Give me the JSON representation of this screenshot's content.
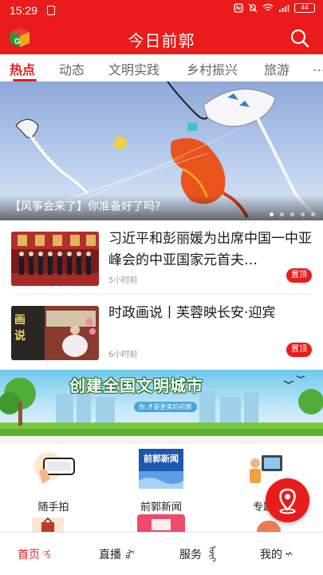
{
  "status_bar": {
    "time": "15:29",
    "battery": "44"
  },
  "header": {
    "title": "今日前郭"
  },
  "tabs": [
    {
      "label": "热点",
      "active": true
    },
    {
      "label": "动态"
    },
    {
      "label": "文明实践"
    },
    {
      "label": "乡村振兴"
    },
    {
      "label": "旅游"
    }
  ],
  "banner": {
    "caption": "【风筝会来了】你准备好了吗?"
  },
  "news": [
    {
      "headline": "习近平和彭丽媛为出席中国一中亚峰会的中亚国家元首夫…",
      "time": "5小时前",
      "pin": "置顶"
    },
    {
      "headline": "时政画说丨芙蓉映长安·迎宾",
      "time": "6小时前",
      "pin": "置顶"
    }
  ],
  "promo": {
    "title": "创建全国文明城市",
    "subtitle": "你,才是更美的前郭"
  },
  "grid": [
    {
      "label": "随手拍",
      "icon": "phone-camera-icon"
    },
    {
      "label": "前郭新闻",
      "icon": "news-logo-icon"
    },
    {
      "label": "专题",
      "icon": "tv-person-icon"
    }
  ],
  "bottom_nav": [
    {
      "label": "首页",
      "active": true
    },
    {
      "label": "直播"
    },
    {
      "label": "服务"
    },
    {
      "label": "我的"
    }
  ],
  "colors": {
    "brand": "#e91b1b"
  }
}
